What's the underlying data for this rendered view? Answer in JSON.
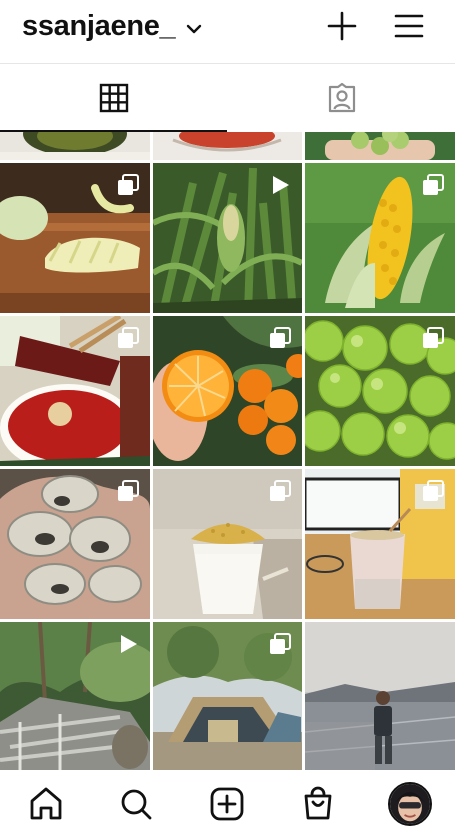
{
  "header": {
    "username": "ssanjaene_",
    "chevron_icon": "chevron-down-icon",
    "add_icon": "plus-icon",
    "menu_icon": "hamburger-menu-icon"
  },
  "tabs": [
    {
      "name": "posts-grid",
      "icon": "grid-icon",
      "active": true
    },
    {
      "name": "tagged",
      "icon": "tagged-person-icon",
      "active": false
    }
  ],
  "posts": [
    {
      "id": "post-pickles-bowl",
      "badge": "none"
    },
    {
      "id": "post-tomato-bowl",
      "badge": "none"
    },
    {
      "id": "post-grapes-hand",
      "badge": "none"
    },
    {
      "id": "post-melon-slices",
      "badge": "carousel-icon"
    },
    {
      "id": "post-corn-field",
      "badge": "video-play-icon"
    },
    {
      "id": "post-yellow-corn",
      "badge": "carousel-icon"
    },
    {
      "id": "post-chili-dip",
      "badge": "carousel-icon"
    },
    {
      "id": "post-tangerines",
      "badge": "carousel-icon"
    },
    {
      "id": "post-green-grapes",
      "badge": "carousel-icon"
    },
    {
      "id": "post-oysters",
      "badge": "carousel-icon"
    },
    {
      "id": "post-latte-glass",
      "badge": "carousel-icon"
    },
    {
      "id": "post-desk-cup",
      "badge": "carousel-icon"
    },
    {
      "id": "post-forest-deck",
      "badge": "video-play-icon"
    },
    {
      "id": "post-camping-tent",
      "badge": "carousel-icon"
    },
    {
      "id": "post-seaside-person",
      "badge": "none"
    }
  ],
  "bottom_nav": [
    {
      "name": "home",
      "icon": "home-icon"
    },
    {
      "name": "search",
      "icon": "search-icon"
    },
    {
      "name": "create",
      "icon": "add-post-icon"
    },
    {
      "name": "shop",
      "icon": "shopping-bag-icon"
    },
    {
      "name": "profile",
      "icon": "profile-avatar-icon"
    }
  ],
  "colors": {
    "text": "#111111",
    "divider": "#e6e6e6",
    "background": "#ffffff"
  }
}
